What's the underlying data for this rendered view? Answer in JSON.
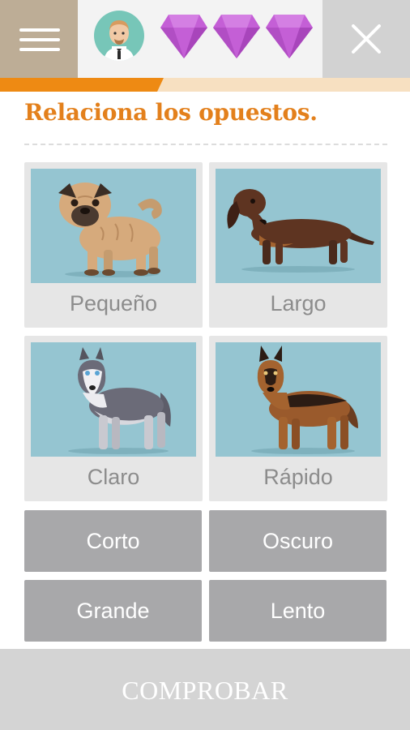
{
  "header": {
    "menu_icon": "hamburger-icon",
    "avatar_icon": "teacher-avatar-icon",
    "lives_icon": "diamond-icon",
    "lives_count": 3,
    "close_icon": "close-icon"
  },
  "progress": {
    "fraction": 0.4
  },
  "instruction": "Relaciona los opuestos.",
  "cards": [
    {
      "label": "Pequeño",
      "image": "pug-dog"
    },
    {
      "label": "Largo",
      "image": "dachshund-dog"
    },
    {
      "label": "Claro",
      "image": "husky-dog"
    },
    {
      "label": "Rápido",
      "image": "german-shepherd-dog"
    }
  ],
  "options": [
    {
      "label": "Corto"
    },
    {
      "label": "Oscuro"
    },
    {
      "label": "Grande"
    },
    {
      "label": "Lento"
    }
  ],
  "check_button": "COMPROBAR",
  "colors": {
    "accent": "#ee8a13",
    "title": "#e3801c",
    "diamond": "#c45fd6",
    "tile": "#a8a8aa",
    "card_bg": "#e6e6e6",
    "picture_bg": "#95c5d1"
  }
}
